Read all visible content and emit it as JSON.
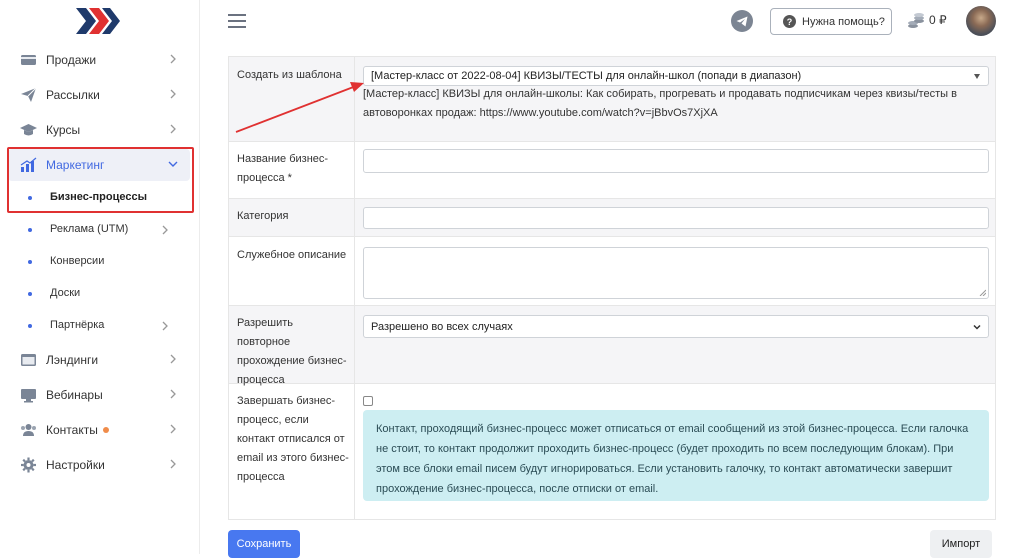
{
  "sidebar": {
    "items": [
      {
        "label": "Продажи",
        "icon": "card-icon"
      },
      {
        "label": "Рассылки",
        "icon": "paper-plane-icon"
      },
      {
        "label": "Курсы",
        "icon": "graduation-cap-icon"
      },
      {
        "label": "Маркетинг",
        "icon": "chart-bars-icon"
      },
      {
        "label": "Лэндинги",
        "icon": "browser-window-icon"
      },
      {
        "label": "Вебинары",
        "icon": "monitor-icon"
      },
      {
        "label": "Контакты",
        "icon": "users-icon"
      },
      {
        "label": "Настройки",
        "icon": "gear-icon"
      }
    ],
    "subitems": [
      {
        "label": "Бизнес-процессы"
      },
      {
        "label": "Реклама (UTM)"
      },
      {
        "label": "Конверсии"
      },
      {
        "label": "Доски"
      },
      {
        "label": "Партнёрка"
      }
    ]
  },
  "header": {
    "help_label": "Нужна помощь?",
    "balance": "0 ₽"
  },
  "form": {
    "template_label": "Создать из шаблона",
    "template_value": "[Мастер-класс от 2022-08-04] КВИЗЫ/ТЕСТЫ для онлайн-школ (попади в диапазон)",
    "template_desc": "[Мастер-класс] КВИЗЫ для онлайн-школы: Как собирать, прогревать и продавать подписчикам через квизы/тесты в автоворонках продаж: https://www.youtube.com/watch?v=jBbvOs7XjXA",
    "name_label": "Название бизнес-процесса *",
    "name_value": "",
    "category_label": "Категория",
    "category_value": "",
    "desc_label": "Служебное описание",
    "desc_value": "",
    "repeat_label": "Разрешить повторное прохождение бизнес-процесса",
    "repeat_value": "Разрешено во всех случаях",
    "finish_label": "Завершать бизнес-процесс, если контакт отписался от email из этого бизнес-процесса",
    "finish_checked": false,
    "finish_info": "Контакт, проходящий бизнес-процесс может отписаться от email сообщений из этой бизнес-процесса. Если галочка не стоит, то контакт продолжит проходить бизнес-процесс (будет проходить по всем последующим блокам). При этом все блоки email писем будут игнорироваться. Если установить галочку, то контакт автоматически завершит прохождение бизнес-процесса, после отписки от email."
  },
  "actions": {
    "save_label": "Сохранить",
    "import_label": "Импорт"
  },
  "colors": {
    "accent": "#4878f0",
    "active_text": "#4169e1",
    "highlight": "#e03131",
    "info_bg": "#cdeef2"
  }
}
